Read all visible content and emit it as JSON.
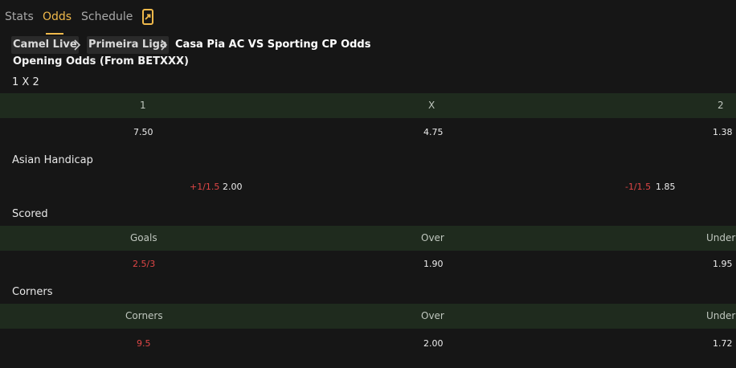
{
  "tabs": [
    {
      "label": "Stats"
    },
    {
      "label": "Odds"
    },
    {
      "label": "Schedule"
    }
  ],
  "colors": {
    "accent": "#f0b94b",
    "negative": "#e04646",
    "header_bg": "#1f2b1e",
    "background": "#161616"
  },
  "breadcrumb": {
    "items": [
      "Camel Live",
      "Primeira Liga"
    ],
    "current": "Casa Pia AC VS Sporting CP Odds"
  },
  "subtitle": "Opening Odds (From BETXXX)",
  "one_x_two": {
    "title": "1 X 2",
    "headers": [
      "1",
      "X",
      "2"
    ],
    "values": [
      "7.50",
      "4.75",
      "1.38"
    ]
  },
  "asian_handicap": {
    "title": "Asian Handicap",
    "home_line": "+1/1.5",
    "home_odds": "2.00",
    "away_line": "-1/1.5",
    "away_odds": "1.85"
  },
  "scored": {
    "title": "Scored",
    "headers": [
      "Goals",
      "Over",
      "Under"
    ],
    "values": [
      "2.5/3",
      "1.90",
      "1.95"
    ]
  },
  "corners": {
    "title": "Corners",
    "headers": [
      "Corners",
      "Over",
      "Under"
    ],
    "values": [
      "9.5",
      "2.00",
      "1.72"
    ]
  }
}
